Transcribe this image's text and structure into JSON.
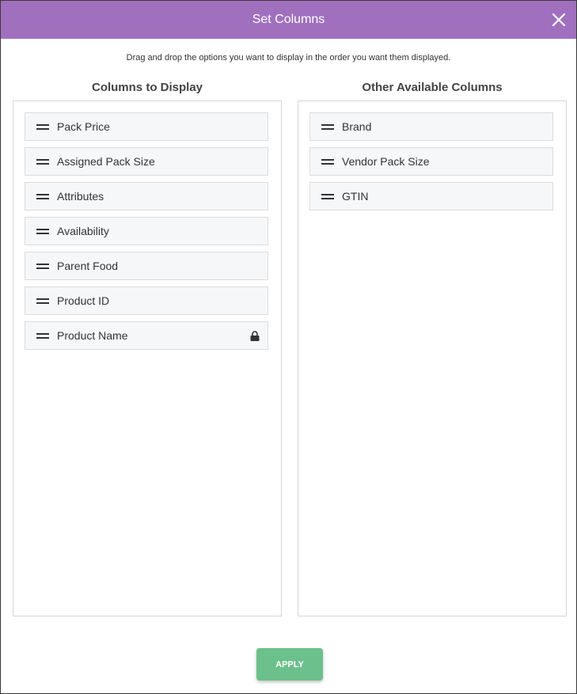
{
  "dialog": {
    "title": "Set Columns",
    "instructions": "Drag and drop the options you want to display in the order you want them displayed.",
    "apply_label": "APPLY",
    "colors": {
      "header": "#a070bf",
      "apply": "#6cc08b"
    }
  },
  "display_columns": {
    "title": "Columns to Display",
    "items": [
      {
        "label": "Pack Price",
        "locked": false
      },
      {
        "label": "Assigned Pack Size",
        "locked": false
      },
      {
        "label": "Attributes",
        "locked": false
      },
      {
        "label": "Availability",
        "locked": false
      },
      {
        "label": "Parent Food",
        "locked": false
      },
      {
        "label": "Product ID",
        "locked": false
      },
      {
        "label": "Product Name",
        "locked": true,
        "icon": "lock-icon"
      }
    ]
  },
  "available_columns": {
    "title": "Other Available Columns",
    "items": [
      {
        "label": "Brand"
      },
      {
        "label": "Vendor Pack Size"
      },
      {
        "label": "GTIN"
      }
    ]
  }
}
